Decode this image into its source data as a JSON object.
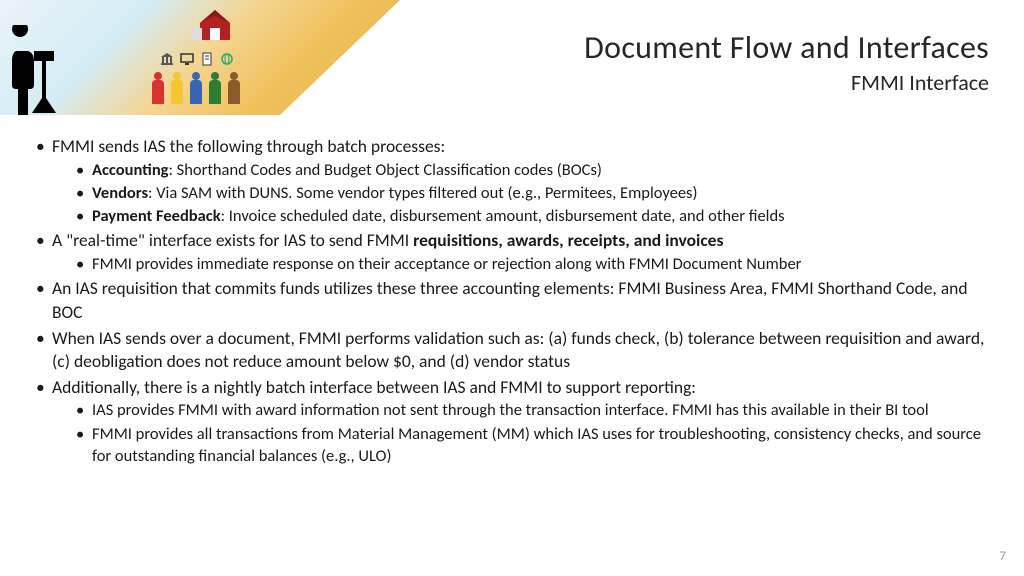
{
  "title": {
    "main": "Document Flow and Interfaces",
    "sub": "FMMI Interface"
  },
  "bullets": {
    "b1": "FMMI sends IAS the following through batch processes:",
    "b1a_label": "Accounting",
    "b1a_text": ": Shorthand Codes and Budget Object Classification codes (BOCs)",
    "b1b_label": "Vendors",
    "b1b_text": ": Via SAM with DUNS. Some vendor types filtered out (e.g., Permitees, Employees)",
    "b1c_label": "Payment Feedback",
    "b1c_text": ": Invoice scheduled date, disbursement amount, disbursement date, and other fields",
    "b2_pre": "A \"real-time\" interface exists for IAS to send FMMI ",
    "b2_bold": "requisitions, awards, receipts, and invoices",
    "b2a": "FMMI provides immediate response on their acceptance or rejection along with FMMI Document Number",
    "b3": "An IAS requisition that commits funds utilizes these three accounting elements: FMMI Business Area, FMMI Shorthand Code, and BOC",
    "b4": "When IAS sends over a document, FMMI performs validation such as: (a) funds check, (b) tolerance between requisition and award, (c) deobligation does not reduce amount below $0, and (d) vendor status",
    "b5": "Additionally, there is a nightly batch interface between IAS and FMMI to support reporting:",
    "b5a": "IAS provides FMMI with award information not sent through the transaction interface.  FMMI has this available in their BI tool",
    "b5b": "FMMI provides all transactions from Material Management (MM) which IAS uses for troubleshooting, consistency checks, and source for outstanding financial balances (e.g., ULO)"
  },
  "page_number": "7",
  "colors": {
    "p1": "#d6332e",
    "p2": "#f4c732",
    "p3": "#3a65b3",
    "p4": "#2e7d32",
    "p5": "#8a5a2b"
  }
}
